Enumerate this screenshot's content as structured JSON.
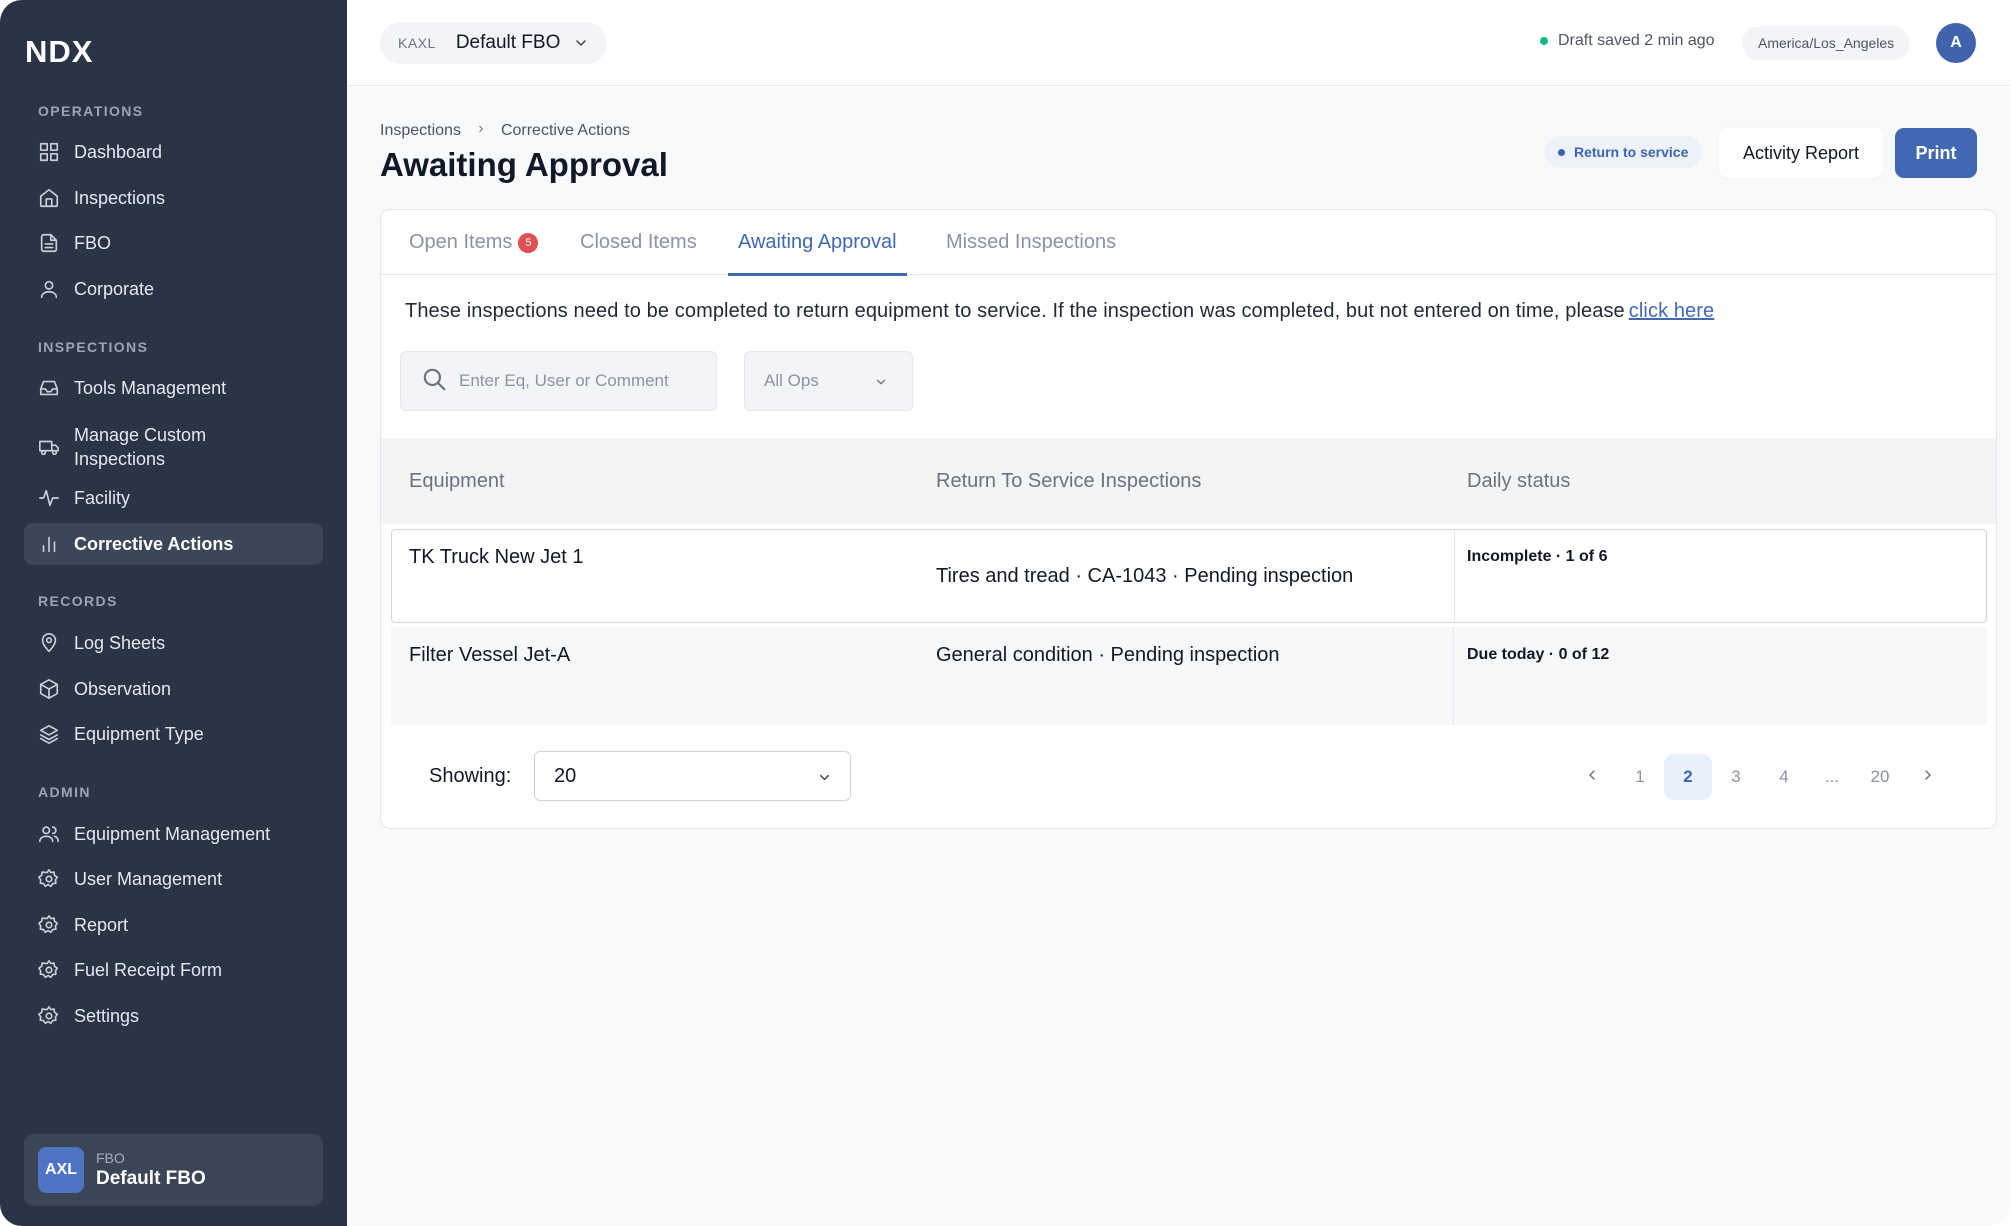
{
  "sidebar": {
    "logo": "NDX",
    "sections": [
      {
        "title": "OPERATIONS",
        "items": [
          {
            "label": "Dashboard",
            "icon": "grid-icon"
          },
          {
            "label": "Inspections",
            "icon": "home-icon"
          },
          {
            "label": "FBO",
            "icon": "file-icon"
          },
          {
            "label": "Corporate",
            "icon": "user-icon"
          }
        ]
      },
      {
        "title": "INSPECTIONS",
        "items": [
          {
            "label": "Tools Management",
            "icon": "inbox-icon"
          },
          {
            "label": "Manage Custom Inspections",
            "icon": "truck-icon"
          },
          {
            "label": "Facility",
            "icon": "activity-icon"
          },
          {
            "label": "Corrective Actions",
            "icon": "bar-chart-icon",
            "active": true
          }
        ]
      },
      {
        "title": "RECORDS",
        "items": [
          {
            "label": "Log Sheets",
            "icon": "map-pin-icon"
          },
          {
            "label": "Observation",
            "icon": "box-icon"
          },
          {
            "label": "Equipment Type",
            "icon": "layers-icon"
          }
        ]
      },
      {
        "title": "ADMIN",
        "items": [
          {
            "label": "Equipment Management",
            "icon": "users-icon"
          },
          {
            "label": "User Management",
            "icon": "gear-icon"
          },
          {
            "label": "Report",
            "icon": "gear-icon"
          },
          {
            "label": "Fuel Receipt Form",
            "icon": "gear-icon"
          },
          {
            "label": "Settings",
            "icon": "gear-icon"
          }
        ]
      }
    ],
    "fbo_card": {
      "avatar": "AXL",
      "label": "FBO",
      "name": "Default FBO"
    }
  },
  "topbar": {
    "fbo_code": "KAXL",
    "fbo_name": "Default FBO",
    "draft_status": "Draft saved 2 min ago",
    "timezone": "America/Los_Angeles",
    "user_initial": "A"
  },
  "header": {
    "breadcrumb": [
      "Inspections",
      "Corrective Actions"
    ],
    "title": "Awaiting Approval",
    "badge": "Return to service",
    "activity_button": "Activity Report",
    "print_button": "Print"
  },
  "tabs": [
    {
      "label": "Open Items",
      "badge": "5"
    },
    {
      "label": "Closed Items"
    },
    {
      "label": "Awaiting Approval",
      "active": true
    },
    {
      "label": "Missed Inspections"
    }
  ],
  "notice": {
    "text": "These inspections need to be completed to return equipment to service. If the inspection was completed, but not entered on time, please",
    "link": "click here"
  },
  "filters": {
    "search_placeholder": "Enter Eq, User or Comment",
    "ops_value": "All Ops"
  },
  "table": {
    "columns": [
      "Equipment",
      "Return To Service Inspections",
      "Daily status"
    ],
    "rows": [
      {
        "equipment": "TK Truck New Jet 1",
        "inspection": "Tires and tread · CA-1043 · Pending inspection",
        "status": "Incomplete · 1 of 6"
      },
      {
        "equipment": "Filter Vessel Jet-A",
        "inspection": "General condition · Pending inspection",
        "status": "Due today · 0 of 12"
      }
    ]
  },
  "pagination": {
    "showing_label": "Showing:",
    "page_size": "20",
    "pages": [
      "1",
      "2",
      "3",
      "4",
      "...",
      "20"
    ],
    "current": "2"
  },
  "colors": {
    "accent": "#4068b3",
    "sidebar_bg": "#2a3444",
    "badge_red": "#e05252",
    "status_green": "#10b981"
  }
}
